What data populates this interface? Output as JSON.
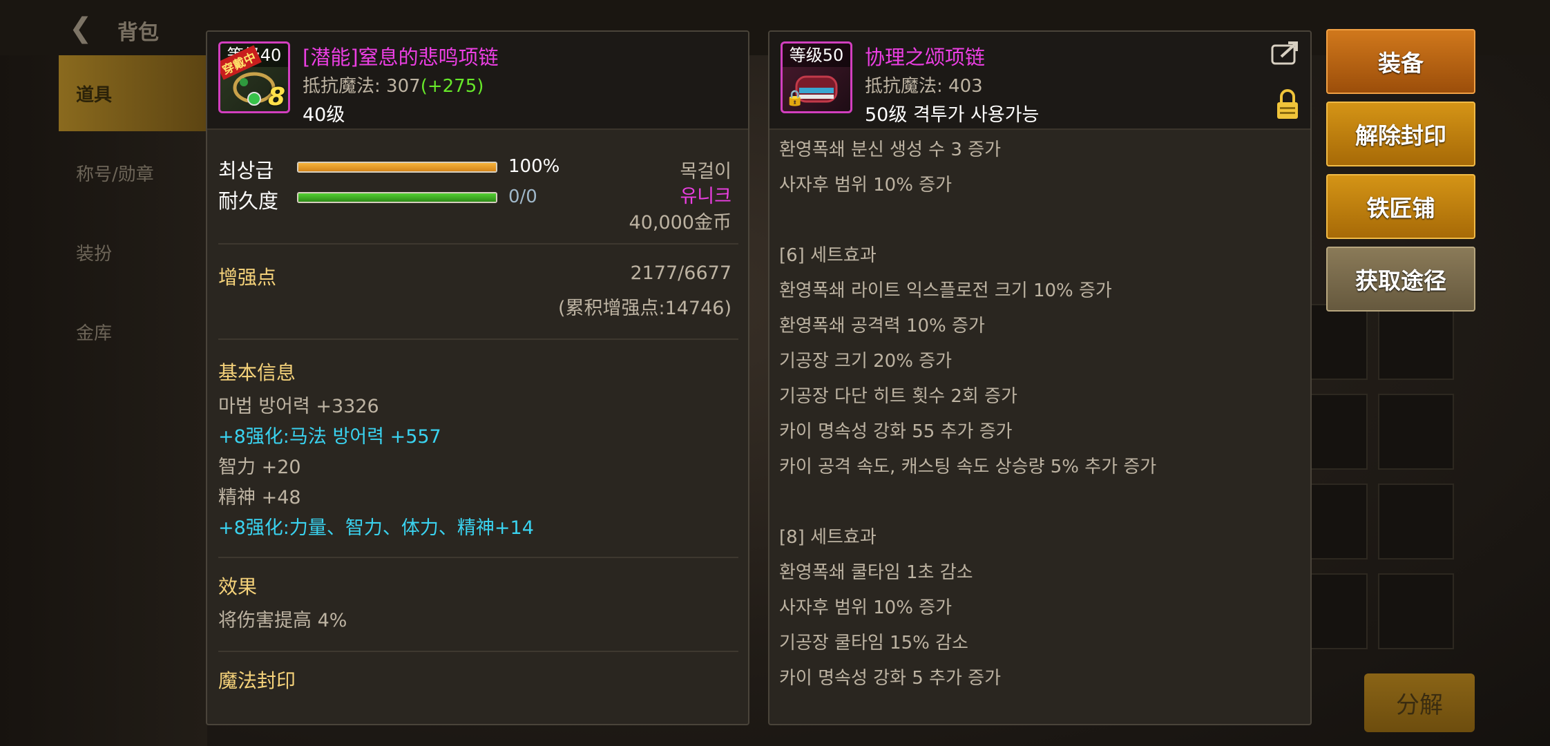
{
  "background": {
    "title": "背包",
    "sidebar": [
      "道具",
      "称号/勋章",
      "装扮",
      "金库"
    ]
  },
  "left_panel": {
    "icon_level": "等级40",
    "icon_badge": "穿戴中",
    "icon_plus": "8",
    "name": "[潜能]窒息的悲鸣项链",
    "stat_label": "抵抗魔法",
    "stat_sep": ":",
    "stat_value": "307",
    "stat_bonus": "(+275)",
    "level": "40级",
    "grade_label": "최상급",
    "grade_pct": "100%",
    "grade_fill": 1.0,
    "durability_label": "耐久度",
    "durability_value": "0/0",
    "durability_fill": 1.0,
    "slot_type": "목걸이",
    "rarity": "유니크",
    "price": "40,000金币",
    "enhance_label": "增强点",
    "enhance_value": "2177/6677",
    "enhance_total": "(累积增强点:14746)",
    "basic_title": "基本信息",
    "basic": [
      {
        "text": "마법 방어력 +3326",
        "cyan": false
      },
      {
        "text": "+8强化:马法 방어력 +557",
        "cyan": true
      },
      {
        "text": "智力 +20",
        "cyan": false
      },
      {
        "text": "精神 +48",
        "cyan": false
      },
      {
        "text": "+8强化:力量、智力、体力、精神+14",
        "cyan": true
      }
    ],
    "effect_title": "效果",
    "effect_text": "将伤害提高 4%",
    "seal_title": "魔法封印"
  },
  "right_panel": {
    "icon_level": "等级50",
    "name": "协理之颂项链",
    "stat_label": "抵抗魔法",
    "stat_sep": ":",
    "stat_value": "403",
    "requirement": "50级 격투가 사용가능",
    "lines": [
      "환영폭쇄 분신 생성 수 3 증가",
      "사자후 범위 10% 증가",
      "",
      "[6] 세트효과",
      "환영폭쇄 라이트 익스플로전 크기 10% 증가",
      "환영폭쇄 공격력 10% 증가",
      "기공장 크기 20% 증가",
      "기공장 다단 히트 횟수 2회 증가",
      "카이 명속성 강화 55 추가 증가",
      "카이 공격 속도, 캐스팅 속도 상승량 5% 추가 증가",
      "",
      "[8] 세트효과",
      "환영폭쇄 쿨타임 1초 감소",
      "사자후 범위 10% 증가",
      "기공장 쿨타임 15% 감소",
      "카이 명속성 강화 5 추가 증가"
    ]
  },
  "actions": {
    "equip": "装备",
    "unseal": "解除封印",
    "smith": "铁匠铺",
    "source": "获取途径"
  },
  "bottom_buttons": [
    "分解"
  ],
  "colors": {
    "magenta": "#ec3fe3",
    "cyan": "#3ad3f0",
    "green": "#67e82a",
    "gold": "#f5d27a"
  }
}
